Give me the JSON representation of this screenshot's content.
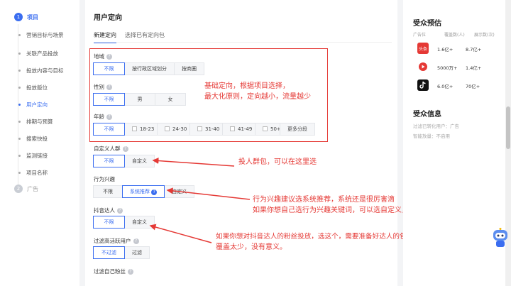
{
  "nav": {
    "step1": {
      "num": "1",
      "title": "项目"
    },
    "items": [
      "营销目标与场景",
      "关联产品投放",
      "投放内容与目标",
      "投放版位",
      "用户定向",
      "排期与预算",
      "搜索快投",
      "监测链接",
      "项目名称"
    ],
    "active_item": "用户定向",
    "step2": {
      "num": "2",
      "title": "广告"
    }
  },
  "main": {
    "title": "用户定向",
    "tabs": [
      "新建定向",
      "选择已有定向包"
    ],
    "region": {
      "label": "地域",
      "options": [
        "不限",
        "按行政区域划分",
        "按商圈"
      ]
    },
    "gender": {
      "label": "性别",
      "options": [
        "不限",
        "男",
        "女"
      ]
    },
    "age": {
      "label": "年龄",
      "options": [
        "不限",
        "18-23",
        "24-30",
        "31-40",
        "41-49",
        "50+",
        "更多分段"
      ]
    },
    "custom_audience": {
      "label": "自定义人群",
      "options": [
        "不限",
        "自定义"
      ]
    },
    "behavior_interest": {
      "label": "行为兴趣",
      "options": [
        "不限",
        "系统推荐",
        "自定义"
      ]
    },
    "douyin_creators": {
      "label": "抖音达人",
      "options": [
        "不限",
        "自定义"
      ]
    },
    "filter_active": {
      "label": "过滤高活跃用户",
      "options": [
        "不过滤",
        "过滤"
      ]
    },
    "filter_own_fans": {
      "label": "过滤自己粉丝"
    }
  },
  "annotations": {
    "note1": [
      "基础定向，根据项目选择，",
      "最大化原则，定向越小，流量越少"
    ],
    "note2": "投人群包，可以在这里选",
    "note3": [
      "行为兴趣建议选系统推荐，系统还是很厉害滴",
      "如果你想自己选行为兴趣关键词，可以选自定义，自己设置"
    ],
    "note4": [
      "如果你想对抖音达人的粉丝投放，选这个，需要准备好达人的包，整体的达人量要大",
      "覆盖太少，没有意义。"
    ]
  },
  "right": {
    "forecast_title": "受众预估",
    "headers": [
      "广告位",
      "覆盖数(人)",
      "展示数(次)"
    ],
    "rows": [
      {
        "logo": "头条",
        "logo_color": "#e53935",
        "cover": "1.6亿+",
        "show": "8.7亿+"
      },
      {
        "logo": "",
        "logo_color": "#e53935",
        "cover": "5000万+",
        "show": "1.4亿+"
      },
      {
        "logo": "",
        "logo_color": "#111111",
        "cover": "6.0亿+",
        "show": "70亿+"
      }
    ],
    "info_title": "受众信息",
    "info_lines": [
      "过滤已转化用户：广告",
      "智能放量：不启用"
    ]
  },
  "colors": {
    "accent": "#3a6df0",
    "annotation": "#e53935"
  }
}
